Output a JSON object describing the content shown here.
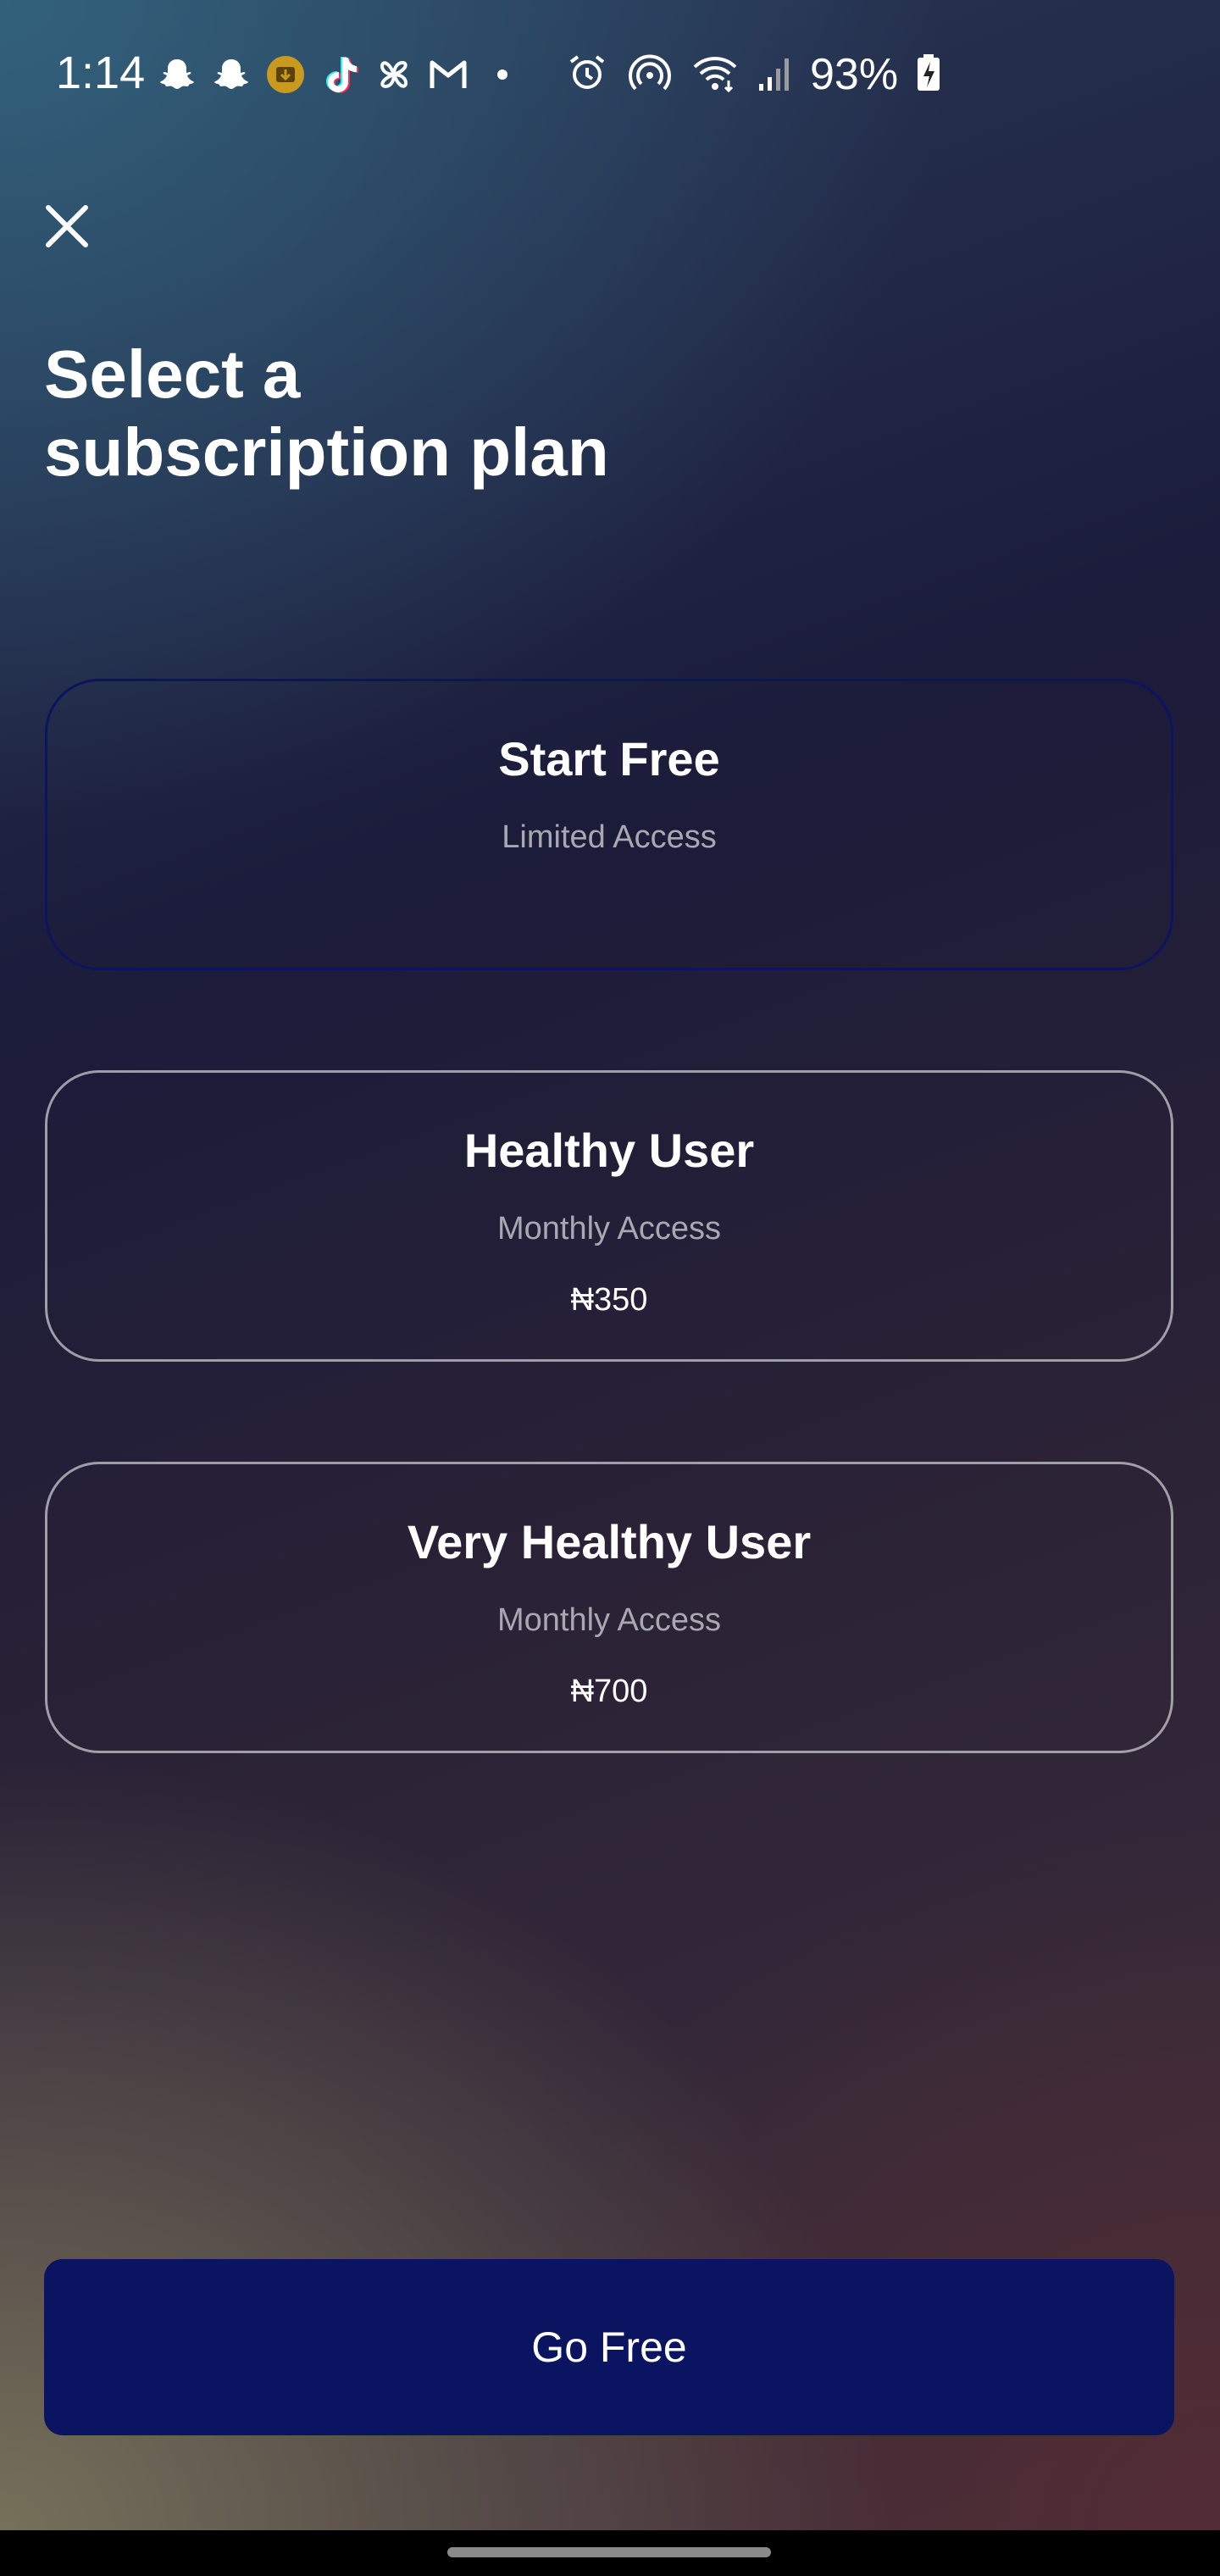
{
  "status_bar": {
    "time": "1:14",
    "battery": "93%",
    "left_icons": [
      "snapchat-icon",
      "snapchat-icon",
      "download-badge-icon",
      "tiktok-icon",
      "pinwheel-icon",
      "gmail-icon",
      "dot-icon"
    ],
    "right_icons": [
      "alarm-icon",
      "hotspot-icon",
      "wifi-icon",
      "signal-icon",
      "battery-charging-icon"
    ]
  },
  "header": {
    "close_icon": "close-icon",
    "title_line1": "Select a",
    "title_line2": "subscription plan"
  },
  "plans": [
    {
      "name": "Start Free",
      "subtitle": "Limited Access",
      "price": "",
      "selected": true
    },
    {
      "name": "Healthy User",
      "subtitle": "Monthly Access",
      "price": "₦350",
      "selected": false
    },
    {
      "name": "Very Healthy User",
      "subtitle": "Monthly Access",
      "price": "₦700",
      "selected": false
    }
  ],
  "cta": {
    "label": "Go Free"
  },
  "colors": {
    "accent": "#0b1461",
    "selected_border": "#0c1460",
    "card_border": "#c8c8cd",
    "muted_text": "#a8a8b0"
  }
}
